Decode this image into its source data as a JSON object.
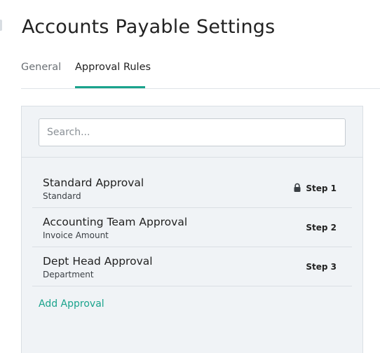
{
  "page": {
    "title": "Accounts Payable Settings"
  },
  "tabs": [
    {
      "label": "General",
      "active": false
    },
    {
      "label": "Approval Rules",
      "active": true
    }
  ],
  "search": {
    "placeholder": "Search...",
    "value": ""
  },
  "approvals": [
    {
      "title": "Standard Approval",
      "subtitle": "Standard",
      "step": "Step 1",
      "locked": true
    },
    {
      "title": "Accounting Team Approval",
      "subtitle": "Invoice Amount",
      "step": "Step 2",
      "locked": false
    },
    {
      "title": "Dept Head Approval",
      "subtitle": "Department",
      "step": "Step 3",
      "locked": false
    }
  ],
  "actions": {
    "add_approval_label": "Add Approval"
  },
  "icons": {
    "lock": "lock-icon"
  },
  "colors": {
    "accent": "#1aa38c",
    "panel_bg": "#f0f3f6",
    "border": "#dadfe4"
  }
}
